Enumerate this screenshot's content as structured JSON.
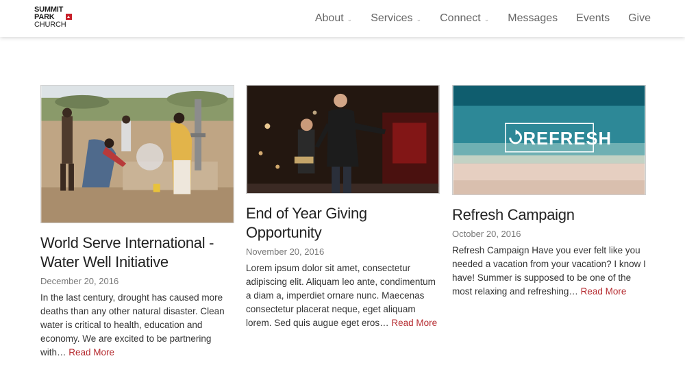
{
  "logo": {
    "line1": "SUMMIT",
    "line2": "PARK",
    "line3": "CHURCH"
  },
  "nav": {
    "items": [
      {
        "label": "About"
      },
      {
        "label": "Services"
      },
      {
        "label": "Connect"
      },
      {
        "label": "Messages"
      },
      {
        "label": "Events"
      },
      {
        "label": "Give"
      }
    ]
  },
  "posts": [
    {
      "title": "World Serve International - Water Well Initiative",
      "date": "December 20, 2016",
      "excerpt": "In the last century, drought has caused more deaths than any other natural disaster. Clean water is critical to health, education and economy. We are excited to be partnering with…",
      "read_more": "Read More"
    },
    {
      "title": "End of Year Giving Opportunity",
      "date": "November 20, 2016",
      "excerpt": "Lorem ipsum dolor sit amet, consectetur adipiscing elit. Aliquam leo ante, condimentum a diam a, imperdiet ornare nunc. Maecenas consectetur placerat neque, eget aliquam lorem. Sed quis augue eget eros…",
      "read_more": "Read More"
    },
    {
      "title": "Refresh Campaign",
      "date": "October 20, 2016",
      "excerpt": "Refresh Campaign Have you ever felt like you needed a vacation from your vacation? I know I have! Summer is supposed to be one of the most relaxing and refreshing…",
      "read_more": "Read More",
      "image_text": "REFRESH"
    }
  ]
}
